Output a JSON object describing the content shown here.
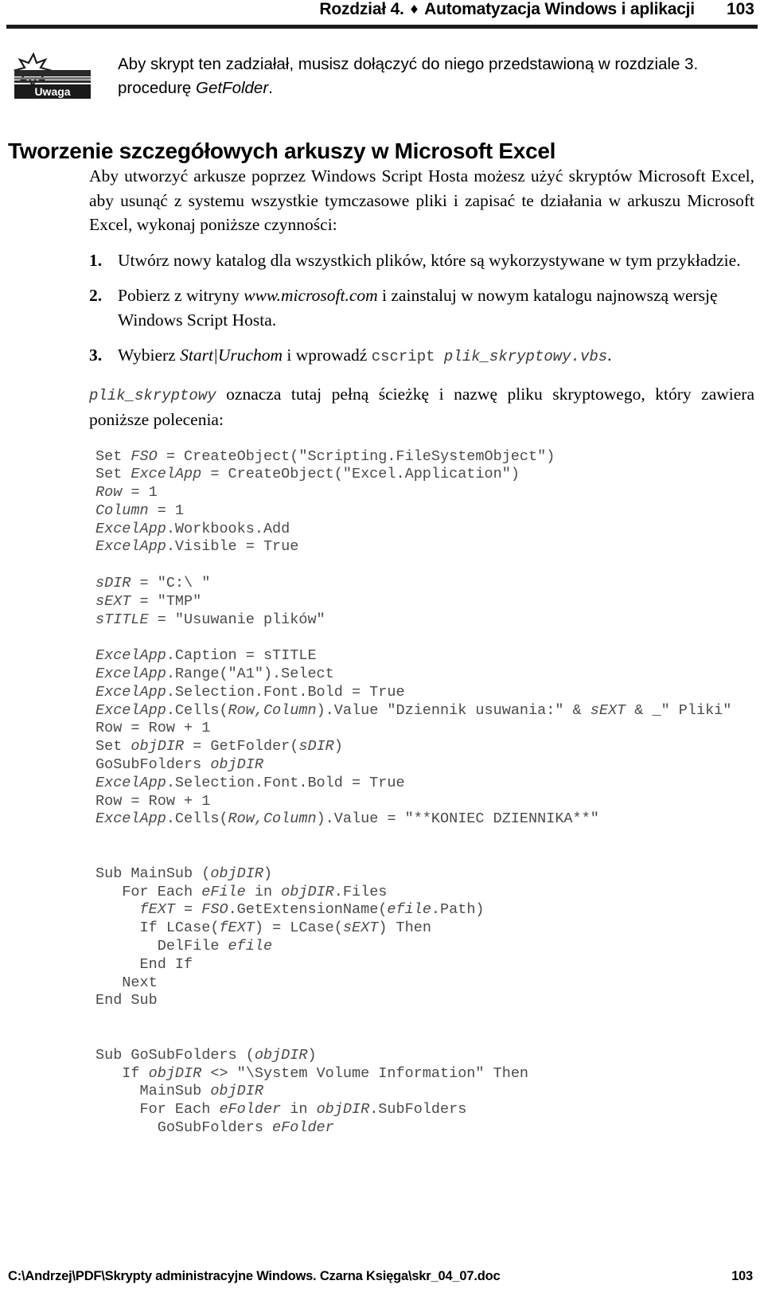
{
  "header": {
    "chapter": "Rozdział 4.",
    "separator": "♦",
    "title": "Automatyzacja Windows i aplikacji",
    "page_number": "103"
  },
  "note": {
    "icon_label": "Uwaga",
    "line1": "Aby skrypt ten zadziałał, musisz dołączyć do niego przedstawioną w rozdziale 3.",
    "line2_prefix": "procedurę ",
    "line2_italic": "GetFolder",
    "line2_suffix": "."
  },
  "section": {
    "heading": "Tworzenie szczegółowych arkuszy w Microsoft Excel",
    "intro": "Aby utworzyć arkusze poprzez Windows Script Hosta możesz użyć skryptów Microsoft Excel, aby usunąć z systemu wszystkie tymczasowe pliki i zapisać te działania w arkuszu Microsoft Excel, wykonaj poniższe czynności:"
  },
  "steps": [
    {
      "number": "1.",
      "parts": [
        {
          "kind": "plain",
          "text": "Utwórz nowy katalog dla wszystkich plików, które są wykorzystywane w tym przykładzie."
        }
      ]
    },
    {
      "number": "2.",
      "parts": [
        {
          "kind": "plain",
          "text": "Pobierz z witryny "
        },
        {
          "kind": "italic",
          "text": "www.microsoft.com"
        },
        {
          "kind": "plain",
          "text": " i zainstaluj w nowym katalogu najnowszą wersję Windows Script Hosta."
        }
      ]
    },
    {
      "number": "3.",
      "parts": [
        {
          "kind": "plain",
          "text": "Wybierz "
        },
        {
          "kind": "italic",
          "text": "Start|Uruchom"
        },
        {
          "kind": "plain",
          "text": " i wprowadź "
        },
        {
          "kind": "mono",
          "text": "cscript "
        },
        {
          "kind": "mono-italic",
          "text": "plik_skryptowy.vbs"
        },
        {
          "kind": "plain",
          "text": "."
        }
      ]
    }
  ],
  "after_list": {
    "mono_italic": "plik_skryptowy",
    "text": " oznacza tutaj pełną ścieżkę i nazwę pliku skryptowego, który zawiera poniższe polecenia:"
  },
  "code": {
    "lines": [
      [
        {
          "i": 1,
          "t": "Set "
        },
        {
          "i": 2,
          "t": "FSO"
        },
        {
          "i": 1,
          "t": " = CreateObject(\"Scripting.FileSystemObject\")"
        }
      ],
      [
        {
          "i": 1,
          "t": "Set "
        },
        {
          "i": 2,
          "t": "ExcelApp"
        },
        {
          "i": 1,
          "t": " = CreateObject(\"Excel.Application\")"
        }
      ],
      [
        {
          "i": 2,
          "t": "Row"
        },
        {
          "i": 1,
          "t": " = 1"
        }
      ],
      [
        {
          "i": 2,
          "t": "Column"
        },
        {
          "i": 1,
          "t": " = 1"
        }
      ],
      [
        {
          "i": 2,
          "t": "ExcelApp"
        },
        {
          "i": 1,
          "t": ".Workbooks.Add"
        }
      ],
      [
        {
          "i": 2,
          "t": "ExcelApp"
        },
        {
          "i": 1,
          "t": ".Visible = True"
        }
      ],
      [
        {
          "i": 1,
          "t": ""
        }
      ],
      [
        {
          "i": 2,
          "t": "sDIR"
        },
        {
          "i": 1,
          "t": " = \"C:\\ \""
        }
      ],
      [
        {
          "i": 2,
          "t": "sEXT"
        },
        {
          "i": 1,
          "t": " = \"TMP\""
        }
      ],
      [
        {
          "i": 2,
          "t": "sTITLE"
        },
        {
          "i": 1,
          "t": " = \"Usuwanie plików\""
        }
      ],
      [
        {
          "i": 1,
          "t": ""
        }
      ],
      [
        {
          "i": 2,
          "t": "ExcelApp"
        },
        {
          "i": 1,
          "t": ".Caption = sTITLE"
        }
      ],
      [
        {
          "i": 2,
          "t": "ExcelApp"
        },
        {
          "i": 1,
          "t": ".Range(\"A1\").Select"
        }
      ],
      [
        {
          "i": 2,
          "t": "ExcelApp"
        },
        {
          "i": 1,
          "t": ".Selection.Font.Bold = True"
        }
      ],
      [
        {
          "i": 2,
          "t": "ExcelApp"
        },
        {
          "i": 1,
          "t": ".Cells("
        },
        {
          "i": 2,
          "t": "Row,Column"
        },
        {
          "i": 1,
          "t": ").Value \"Dziennik usuwania:\" & "
        },
        {
          "i": 2,
          "t": "sEXT"
        },
        {
          "i": 1,
          "t": " & _\" Pliki\""
        }
      ],
      [
        {
          "i": 1,
          "t": "Row = Row + 1"
        }
      ],
      [
        {
          "i": 1,
          "t": "Set "
        },
        {
          "i": 2,
          "t": "objDIR"
        },
        {
          "i": 1,
          "t": " = GetFolder("
        },
        {
          "i": 2,
          "t": "sDIR"
        },
        {
          "i": 1,
          "t": ")"
        }
      ],
      [
        {
          "i": 1,
          "t": "GoSubFolders "
        },
        {
          "i": 2,
          "t": "objDIR"
        }
      ],
      [
        {
          "i": 2,
          "t": "ExcelApp"
        },
        {
          "i": 1,
          "t": ".Selection.Font.Bold = True"
        }
      ],
      [
        {
          "i": 1,
          "t": "Row = Row + 1"
        }
      ],
      [
        {
          "i": 2,
          "t": "ExcelApp"
        },
        {
          "i": 1,
          "t": ".Cells("
        },
        {
          "i": 2,
          "t": "Row,Column"
        },
        {
          "i": 1,
          "t": ").Value = \"**KONIEC DZIENNIKA**\""
        }
      ],
      [
        {
          "i": 1,
          "t": ""
        }
      ],
      [
        {
          "i": 1,
          "t": ""
        }
      ],
      [
        {
          "i": 1,
          "t": "Sub MainSub ("
        },
        {
          "i": 2,
          "t": "objDIR"
        },
        {
          "i": 1,
          "t": ")"
        }
      ],
      [
        {
          "i": 1,
          "t": "   For Each "
        },
        {
          "i": 2,
          "t": "eFile"
        },
        {
          "i": 1,
          "t": " in "
        },
        {
          "i": 2,
          "t": "objDIR"
        },
        {
          "i": 1,
          "t": ".Files"
        }
      ],
      [
        {
          "i": 1,
          "t": "     "
        },
        {
          "i": 2,
          "t": "fEXT"
        },
        {
          "i": 1,
          "t": " = "
        },
        {
          "i": 2,
          "t": "FSO"
        },
        {
          "i": 1,
          "t": ".GetExtensionName("
        },
        {
          "i": 2,
          "t": "efile"
        },
        {
          "i": 1,
          "t": ".Path)"
        }
      ],
      [
        {
          "i": 1,
          "t": "     If LCase("
        },
        {
          "i": 2,
          "t": "fEXT"
        },
        {
          "i": 1,
          "t": ") = LCase("
        },
        {
          "i": 2,
          "t": "sEXT"
        },
        {
          "i": 1,
          "t": ") Then"
        }
      ],
      [
        {
          "i": 1,
          "t": "       DelFile "
        },
        {
          "i": 2,
          "t": "efile"
        }
      ],
      [
        {
          "i": 1,
          "t": "     End If"
        }
      ],
      [
        {
          "i": 1,
          "t": "   Next"
        }
      ],
      [
        {
          "i": 1,
          "t": "End Sub"
        }
      ],
      [
        {
          "i": 1,
          "t": ""
        }
      ],
      [
        {
          "i": 1,
          "t": ""
        }
      ],
      [
        {
          "i": 1,
          "t": "Sub GoSubFolders ("
        },
        {
          "i": 2,
          "t": "objDIR"
        },
        {
          "i": 1,
          "t": ")"
        }
      ],
      [
        {
          "i": 1,
          "t": "   If "
        },
        {
          "i": 2,
          "t": "objDIR"
        },
        {
          "i": 1,
          "t": " <> \"\\System Volume Information\" Then"
        }
      ],
      [
        {
          "i": 1,
          "t": "     MainSub "
        },
        {
          "i": 2,
          "t": "objDIR"
        }
      ],
      [
        {
          "i": 1,
          "t": "     For Each "
        },
        {
          "i": 2,
          "t": "eFolder"
        },
        {
          "i": 1,
          "t": " in "
        },
        {
          "i": 2,
          "t": "objDIR"
        },
        {
          "i": 1,
          "t": ".SubFolders"
        }
      ],
      [
        {
          "i": 1,
          "t": "       GoSubFolders "
        },
        {
          "i": 2,
          "t": "eFolder"
        }
      ]
    ]
  },
  "footer": {
    "path": "C:\\Andrzej\\PDF\\Skrypty administracyjne Windows. Czarna Księga\\skr_04_07.doc",
    "page_number": "103"
  }
}
